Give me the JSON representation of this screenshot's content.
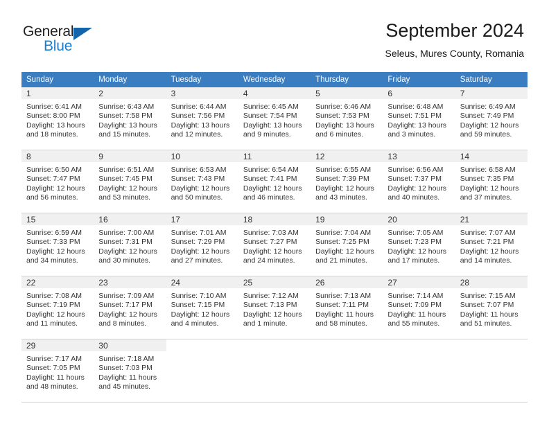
{
  "brand": {
    "name_part1": "General",
    "name_part2": "Blue",
    "accent_color": "#1a7fd4",
    "triangle_color": "#1464ac"
  },
  "header": {
    "title": "September 2024",
    "subtitle": "Seleus, Mures County, Romania"
  },
  "calendar": {
    "header_bg": "#3a7dc0",
    "daynum_bg": "#f0f0f0",
    "weekdays": [
      "Sunday",
      "Monday",
      "Tuesday",
      "Wednesday",
      "Thursday",
      "Friday",
      "Saturday"
    ],
    "weeks": [
      [
        {
          "day": "1",
          "sunrise": "Sunrise: 6:41 AM",
          "sunset": "Sunset: 8:00 PM",
          "daylight": "Daylight: 13 hours and 18 minutes."
        },
        {
          "day": "2",
          "sunrise": "Sunrise: 6:43 AM",
          "sunset": "Sunset: 7:58 PM",
          "daylight": "Daylight: 13 hours and 15 minutes."
        },
        {
          "day": "3",
          "sunrise": "Sunrise: 6:44 AM",
          "sunset": "Sunset: 7:56 PM",
          "daylight": "Daylight: 13 hours and 12 minutes."
        },
        {
          "day": "4",
          "sunrise": "Sunrise: 6:45 AM",
          "sunset": "Sunset: 7:54 PM",
          "daylight": "Daylight: 13 hours and 9 minutes."
        },
        {
          "day": "5",
          "sunrise": "Sunrise: 6:46 AM",
          "sunset": "Sunset: 7:53 PM",
          "daylight": "Daylight: 13 hours and 6 minutes."
        },
        {
          "day": "6",
          "sunrise": "Sunrise: 6:48 AM",
          "sunset": "Sunset: 7:51 PM",
          "daylight": "Daylight: 13 hours and 3 minutes."
        },
        {
          "day": "7",
          "sunrise": "Sunrise: 6:49 AM",
          "sunset": "Sunset: 7:49 PM",
          "daylight": "Daylight: 12 hours and 59 minutes."
        }
      ],
      [
        {
          "day": "8",
          "sunrise": "Sunrise: 6:50 AM",
          "sunset": "Sunset: 7:47 PM",
          "daylight": "Daylight: 12 hours and 56 minutes."
        },
        {
          "day": "9",
          "sunrise": "Sunrise: 6:51 AM",
          "sunset": "Sunset: 7:45 PM",
          "daylight": "Daylight: 12 hours and 53 minutes."
        },
        {
          "day": "10",
          "sunrise": "Sunrise: 6:53 AM",
          "sunset": "Sunset: 7:43 PM",
          "daylight": "Daylight: 12 hours and 50 minutes."
        },
        {
          "day": "11",
          "sunrise": "Sunrise: 6:54 AM",
          "sunset": "Sunset: 7:41 PM",
          "daylight": "Daylight: 12 hours and 46 minutes."
        },
        {
          "day": "12",
          "sunrise": "Sunrise: 6:55 AM",
          "sunset": "Sunset: 7:39 PM",
          "daylight": "Daylight: 12 hours and 43 minutes."
        },
        {
          "day": "13",
          "sunrise": "Sunrise: 6:56 AM",
          "sunset": "Sunset: 7:37 PM",
          "daylight": "Daylight: 12 hours and 40 minutes."
        },
        {
          "day": "14",
          "sunrise": "Sunrise: 6:58 AM",
          "sunset": "Sunset: 7:35 PM",
          "daylight": "Daylight: 12 hours and 37 minutes."
        }
      ],
      [
        {
          "day": "15",
          "sunrise": "Sunrise: 6:59 AM",
          "sunset": "Sunset: 7:33 PM",
          "daylight": "Daylight: 12 hours and 34 minutes."
        },
        {
          "day": "16",
          "sunrise": "Sunrise: 7:00 AM",
          "sunset": "Sunset: 7:31 PM",
          "daylight": "Daylight: 12 hours and 30 minutes."
        },
        {
          "day": "17",
          "sunrise": "Sunrise: 7:01 AM",
          "sunset": "Sunset: 7:29 PM",
          "daylight": "Daylight: 12 hours and 27 minutes."
        },
        {
          "day": "18",
          "sunrise": "Sunrise: 7:03 AM",
          "sunset": "Sunset: 7:27 PM",
          "daylight": "Daylight: 12 hours and 24 minutes."
        },
        {
          "day": "19",
          "sunrise": "Sunrise: 7:04 AM",
          "sunset": "Sunset: 7:25 PM",
          "daylight": "Daylight: 12 hours and 21 minutes."
        },
        {
          "day": "20",
          "sunrise": "Sunrise: 7:05 AM",
          "sunset": "Sunset: 7:23 PM",
          "daylight": "Daylight: 12 hours and 17 minutes."
        },
        {
          "day": "21",
          "sunrise": "Sunrise: 7:07 AM",
          "sunset": "Sunset: 7:21 PM",
          "daylight": "Daylight: 12 hours and 14 minutes."
        }
      ],
      [
        {
          "day": "22",
          "sunrise": "Sunrise: 7:08 AM",
          "sunset": "Sunset: 7:19 PM",
          "daylight": "Daylight: 12 hours and 11 minutes."
        },
        {
          "day": "23",
          "sunrise": "Sunrise: 7:09 AM",
          "sunset": "Sunset: 7:17 PM",
          "daylight": "Daylight: 12 hours and 8 minutes."
        },
        {
          "day": "24",
          "sunrise": "Sunrise: 7:10 AM",
          "sunset": "Sunset: 7:15 PM",
          "daylight": "Daylight: 12 hours and 4 minutes."
        },
        {
          "day": "25",
          "sunrise": "Sunrise: 7:12 AM",
          "sunset": "Sunset: 7:13 PM",
          "daylight": "Daylight: 12 hours and 1 minute."
        },
        {
          "day": "26",
          "sunrise": "Sunrise: 7:13 AM",
          "sunset": "Sunset: 7:11 PM",
          "daylight": "Daylight: 11 hours and 58 minutes."
        },
        {
          "day": "27",
          "sunrise": "Sunrise: 7:14 AM",
          "sunset": "Sunset: 7:09 PM",
          "daylight": "Daylight: 11 hours and 55 minutes."
        },
        {
          "day": "28",
          "sunrise": "Sunrise: 7:15 AM",
          "sunset": "Sunset: 7:07 PM",
          "daylight": "Daylight: 11 hours and 51 minutes."
        }
      ],
      [
        {
          "day": "29",
          "sunrise": "Sunrise: 7:17 AM",
          "sunset": "Sunset: 7:05 PM",
          "daylight": "Daylight: 11 hours and 48 minutes."
        },
        {
          "day": "30",
          "sunrise": "Sunrise: 7:18 AM",
          "sunset": "Sunset: 7:03 PM",
          "daylight": "Daylight: 11 hours and 45 minutes."
        },
        {
          "day": "",
          "sunrise": "",
          "sunset": "",
          "daylight": ""
        },
        {
          "day": "",
          "sunrise": "",
          "sunset": "",
          "daylight": ""
        },
        {
          "day": "",
          "sunrise": "",
          "sunset": "",
          "daylight": ""
        },
        {
          "day": "",
          "sunrise": "",
          "sunset": "",
          "daylight": ""
        },
        {
          "day": "",
          "sunrise": "",
          "sunset": "",
          "daylight": ""
        }
      ]
    ]
  }
}
